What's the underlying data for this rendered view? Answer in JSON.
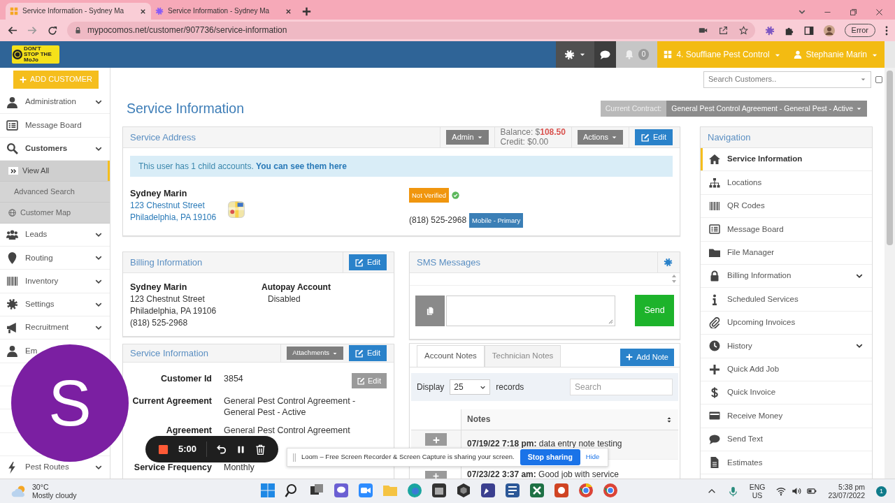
{
  "browser": {
    "tabs": [
      {
        "title": "Service Information - Sydney Ma",
        "selected": true
      },
      {
        "title": "Service Information - Sydney Ma",
        "selected": false
      }
    ],
    "url": "mypocomos.net/customer/907736/service-information",
    "profile_button": "Error"
  },
  "header": {
    "logo_text": "DON'T STOP THE MoJo",
    "notification_count": "0",
    "company": "4. Souffiane Pest Control",
    "user": "Stephanie Marin"
  },
  "sidebar": {
    "add_button": "ADD CUSTOMER",
    "items": [
      {
        "label": "Administration",
        "expandable": true
      },
      {
        "label": "Message Board",
        "expandable": false
      },
      {
        "label": "Customers",
        "expandable": true,
        "children": [
          {
            "label": "View All",
            "selected": true
          },
          {
            "label": "Advanced Search",
            "selected": false
          },
          {
            "label": "Customer Map",
            "selected": false
          }
        ]
      },
      {
        "label": "Leads",
        "expandable": true
      },
      {
        "label": "Routing",
        "expandable": true
      },
      {
        "label": "Inventory",
        "expandable": true
      },
      {
        "label": "Settings",
        "expandable": true
      },
      {
        "label": "Recruitment",
        "expandable": true
      },
      {
        "label": "Em",
        "expandable": false
      },
      {
        "kind": "covered"
      },
      {
        "kind": "covered"
      },
      {
        "kind": "covered"
      },
      {
        "kind": "covered"
      },
      {
        "label": "Pest Routes",
        "expandable": true
      }
    ]
  },
  "search_customers": {
    "placeholder": "Search Customers.."
  },
  "filter_checkbox": {
    "checked": false
  },
  "page_title": "Service Information",
  "contract": {
    "label": "Current Contract:",
    "value": "General Pest Control Agreement - General Pest - Active"
  },
  "service_address": {
    "title": "Service Address",
    "admin_button": "Admin",
    "balance_label": "Balance: $",
    "balance": "108.50",
    "credit": "Credit: $0.00",
    "actions_button": "Actions",
    "edit_button": "Edit",
    "alert": "This user has 1 child accounts.",
    "alert_link": "You can see them here",
    "name": "Sydney Marin",
    "street": "123 Chestnut Street",
    "city": "Philadelphia, PA 19106",
    "verification": "Not Verified",
    "phone": "(818) 525-2968",
    "phone_type": "Mobile - Primary"
  },
  "billing": {
    "title": "Billing Information",
    "edit_button": "Edit",
    "name": "Sydney Marin",
    "street": "123 Chestnut Street",
    "city": "Philadelphia, PA 19106",
    "phone": "(818) 525-2968",
    "autopay_label": "Autopay Account",
    "autopay_value": "Disabled"
  },
  "service_info": {
    "title": "Service Information",
    "attachments_button": "Attachments",
    "edit_button": "Edit",
    "rows": [
      {
        "label": "Customer Id",
        "value": "3854",
        "edit_button": "Edit"
      },
      {
        "label": "Current Agreement",
        "value": "General Pest Control Agreement - General Pest - Active"
      },
      {
        "label": "Agreement",
        "value": "General Pest Control Agreement"
      },
      {
        "kind": "covered"
      },
      {
        "label": "Service Frequency",
        "value": "Monthly"
      }
    ]
  },
  "sms": {
    "title": "SMS Messages",
    "send_button": "Send"
  },
  "notes": {
    "tabs": [
      {
        "label": "Account Notes",
        "selected": true
      },
      {
        "label": "Technician Notes",
        "selected": false
      }
    ],
    "add_button": "Add Note",
    "display_label": "Display",
    "page_size": "25",
    "records_label": "records",
    "search_placeholder": "Search",
    "column": "Notes",
    "rows": [
      {
        "text": "**07/19/22 7:18 pm:** data entry note testing"
      },
      {
        "text": "**07/23/22 3:37 am:** Good job with service"
      }
    ]
  },
  "navigation": {
    "title": "Navigation",
    "items": [
      {
        "label": "Service Information",
        "selected": true,
        "expandable": false
      },
      {
        "label": "Locations",
        "selected": false,
        "expandable": false
      },
      {
        "label": "QR Codes",
        "selected": false,
        "expandable": false
      },
      {
        "label": "Message Board",
        "selected": false,
        "expandable": false
      },
      {
        "label": "File Manager",
        "selected": false,
        "expandable": false
      },
      {
        "label": "Billing Information",
        "selected": false,
        "expandable": true
      },
      {
        "label": "Scheduled Services",
        "selected": false,
        "expandable": false
      },
      {
        "label": "Upcoming Invoices",
        "selected": false,
        "expandable": false
      },
      {
        "label": "History",
        "selected": false,
        "expandable": true
      },
      {
        "label": "Quick Add Job",
        "selected": false,
        "expandable": false
      },
      {
        "label": "Quick Invoice",
        "selected": false,
        "expandable": false
      },
      {
        "label": "Receive Money",
        "selected": false,
        "expandable": false
      },
      {
        "label": "Send Text",
        "selected": false,
        "expandable": false
      },
      {
        "label": "Estimates",
        "selected": false,
        "expandable": false
      }
    ]
  },
  "recorder": {
    "time": "5:00"
  },
  "loom_banner": {
    "message": "Loom – Free Screen Recorder & Screen Capture is sharing your screen.",
    "stop_button": "Stop sharing",
    "hide_link": "Hide"
  },
  "loom_bubble": {
    "initial": "S"
  },
  "taskbar": {
    "temperature": "30°C",
    "weather": "Mostly cloudy",
    "language": "ENG",
    "region": "US",
    "time": "5:38 pm",
    "date": "23/07/2022",
    "notification_count": "1"
  }
}
